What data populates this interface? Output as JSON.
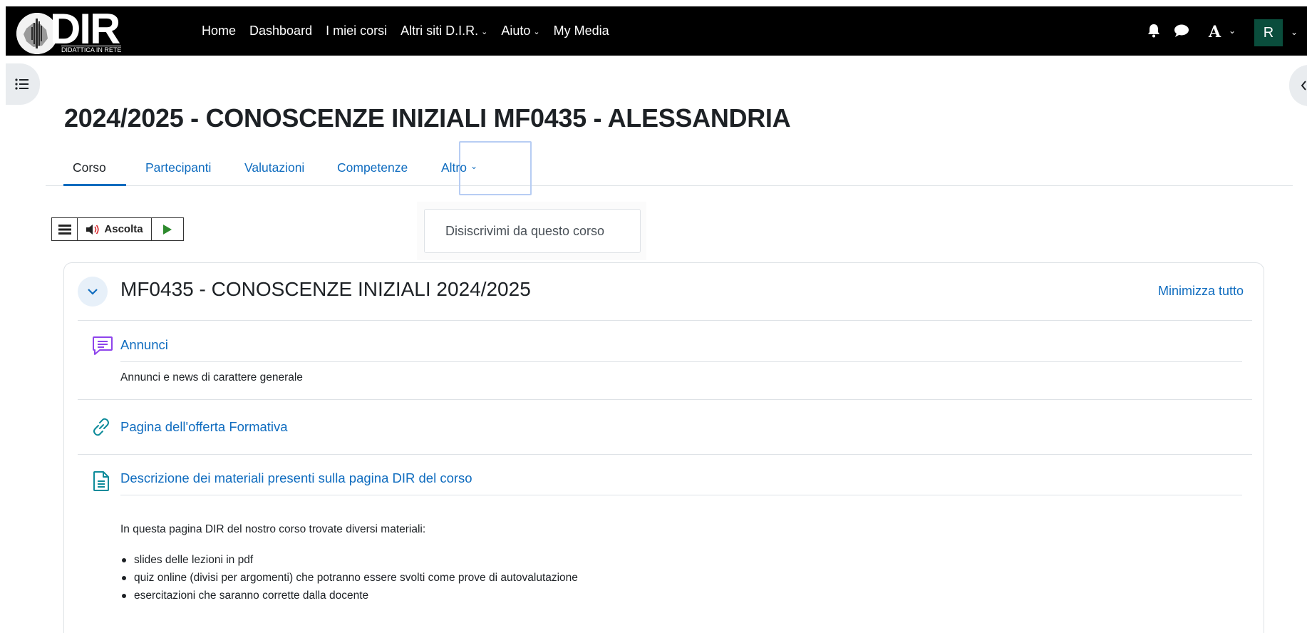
{
  "navbar": {
    "logo_text": "DIR",
    "logo_subtitle": "DIDATTICA IN RETE",
    "menu": [
      {
        "label": "Home",
        "has_caret": false
      },
      {
        "label": "Dashboard",
        "has_caret": false
      },
      {
        "label": "I miei corsi",
        "has_caret": false
      },
      {
        "label": "Altri siti D.I.R.",
        "has_caret": true
      },
      {
        "label": "Aiuto",
        "has_caret": true
      },
      {
        "label": "My Media",
        "has_caret": false
      }
    ],
    "icons": [
      "bell-icon",
      "chat-icon",
      "text-size-icon"
    ],
    "font_label": "A",
    "user_initial": "R"
  },
  "page": {
    "title": "2024/2025 - CONOSCENZE INIZIALI MF0435 - ALESSANDRIA"
  },
  "tabs": [
    {
      "label": "Corso",
      "active": true
    },
    {
      "label": "Partecipanti",
      "active": false
    },
    {
      "label": "Valutazioni",
      "active": false
    },
    {
      "label": "Competenze",
      "active": false
    },
    {
      "label": "Altro",
      "active": false
    }
  ],
  "altro_dropdown": {
    "items": [
      "Disiscrivimi da questo corso"
    ]
  },
  "readspeaker": {
    "listen_label": "Ascolta"
  },
  "section": {
    "title": "MF0435 - CONOSCENZE INIZIALI 2024/2025",
    "collapse_all": "Minimizza tutto",
    "activities": [
      {
        "icon": "forum-icon",
        "name": "Annunci",
        "description": "Annunci e news di carattere generale"
      },
      {
        "icon": "url-link-icon",
        "name": "Pagina dell'offerta Formativa"
      },
      {
        "icon": "page-icon",
        "name": "Descrizione dei materiali presenti sulla pagina DIR del corso",
        "intro": "In questa pagina DIR del nostro corso trovate diversi materiali:",
        "bullets": [
          "slides delle lezioni in pdf",
          "quiz online (divisi per argomenti) che potranno essere svolti come prove di autovalutazione",
          "esercitazioni che saranno corrette dalla docente"
        ]
      }
    ]
  },
  "colors": {
    "navbar_bg": "#000000",
    "link": "#0f6cbf",
    "avatar_bg": "#0a4d3c",
    "forum_icon": "#8e44ec",
    "resource_icon": "#0d8b9a"
  }
}
